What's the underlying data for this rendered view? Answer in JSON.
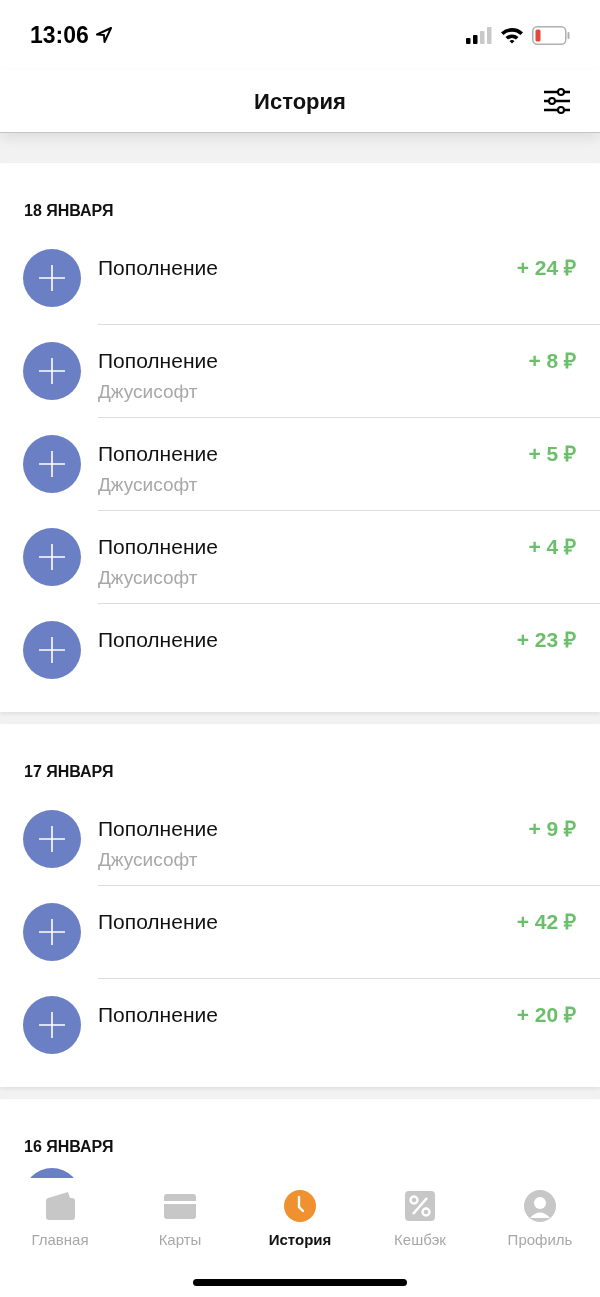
{
  "status_bar": {
    "time": "13:06"
  },
  "header": {
    "title": "История"
  },
  "sections": [
    {
      "date": "18 ЯНВАРЯ",
      "transactions": [
        {
          "kind": "full",
          "title": "Пополнение",
          "amount": "+ 24 ₽"
        },
        {
          "kind": "full",
          "title": "Пополнение",
          "subtitle": "Джусисофт",
          "amount": "+ 8 ₽"
        },
        {
          "kind": "full",
          "title": "Пополнение",
          "subtitle": "Джусисофт",
          "amount": "+ 5 ₽"
        },
        {
          "kind": "full",
          "title": "Пополнение",
          "subtitle": "Джусисофт",
          "amount": "+ 4 ₽"
        },
        {
          "kind": "full",
          "title": "Пополнение",
          "amount": "+ 23 ₽"
        }
      ]
    },
    {
      "date": "17 ЯНВАРЯ",
      "transactions": [
        {
          "kind": "full",
          "title": "Пополнение",
          "subtitle": "Джусисофт",
          "amount": "+ 9 ₽"
        },
        {
          "kind": "full",
          "title": "Пополнение",
          "amount": "+ 42 ₽"
        },
        {
          "kind": "full",
          "title": "Пополнение",
          "amount": "+ 20 ₽"
        }
      ]
    },
    {
      "date": "16 ЯНВАРЯ",
      "transactions": [
        {
          "kind": "icon_only"
        }
      ]
    }
  ],
  "tab_bar": [
    {
      "label": "Главная",
      "selected": false
    },
    {
      "label": "Карты",
      "selected": false
    },
    {
      "label": "История",
      "selected": true
    },
    {
      "label": "Кешбэк",
      "selected": false
    },
    {
      "label": "Профиль",
      "selected": false
    }
  ]
}
